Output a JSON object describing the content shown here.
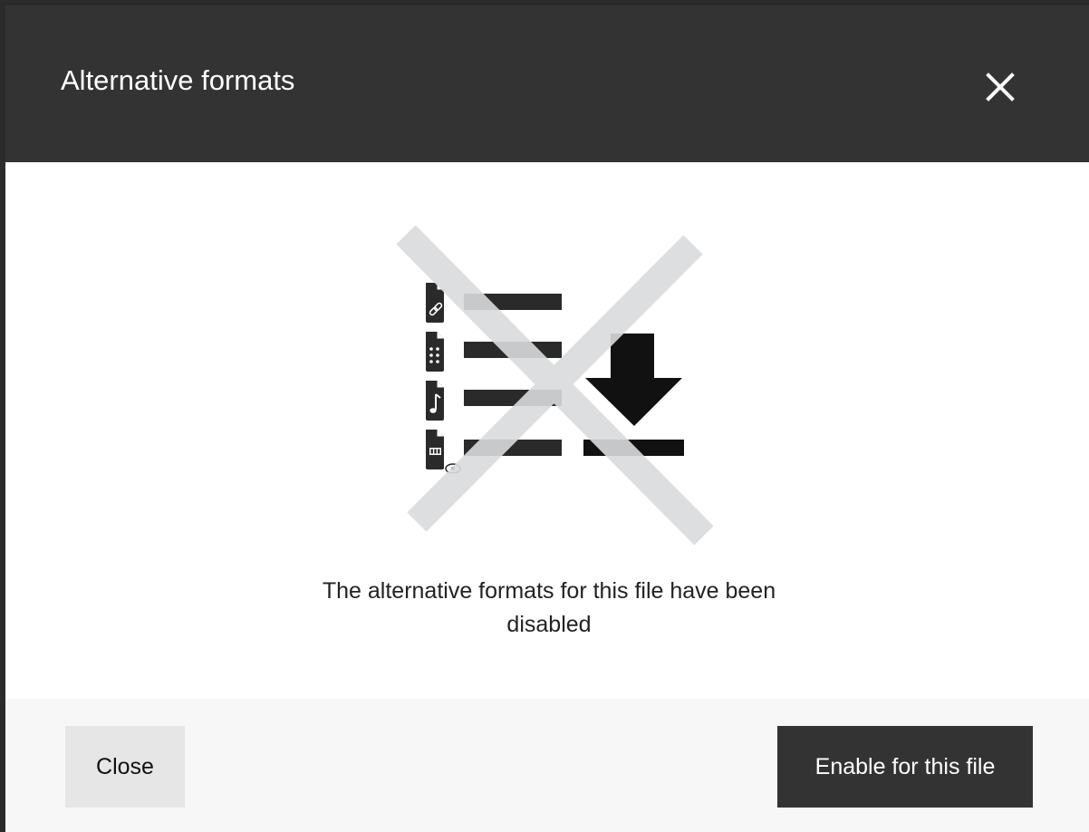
{
  "dialog": {
    "title": "Alternative formats",
    "close_icon": "close-icon",
    "message": "The alternative formats for this file have been disabled",
    "illustration_icon": "alternative-formats-disabled-icon"
  },
  "footer": {
    "close_label": "Close",
    "enable_label": "Enable for this file"
  },
  "colors": {
    "header_bg": "#333333",
    "footer_bg": "#f7f7f7",
    "secondary_button_bg": "#e6e6e6",
    "primary_button_bg": "#333333",
    "strike_cross": "#d9dbdd"
  }
}
